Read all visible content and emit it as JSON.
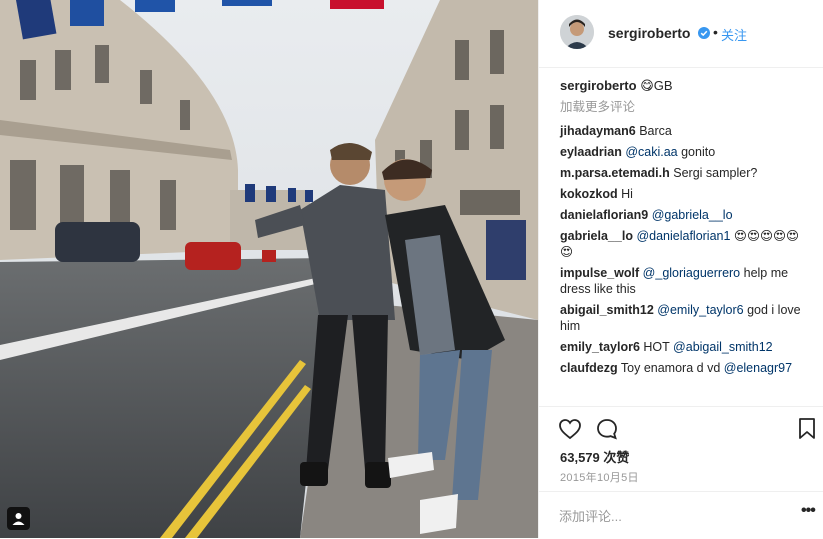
{
  "post": {
    "username": "sergiroberto",
    "separator": "•",
    "follow_label": "关注",
    "caption_user": "sergiroberto",
    "caption_text": "😋GB",
    "load_more_label": "加载更多评论",
    "comments": [
      {
        "user": "jihadayman6",
        "parts": [
          {
            "t": "Barca"
          }
        ]
      },
      {
        "user": "eylaadrian",
        "parts": [
          {
            "m": "@caki.aa"
          },
          {
            "t": " gonito"
          }
        ]
      },
      {
        "user": "m.parsa.etemadi.h",
        "parts": [
          {
            "t": "Sergi sampler?"
          }
        ]
      },
      {
        "user": "kokozkod",
        "parts": [
          {
            "t": "Hi"
          }
        ]
      },
      {
        "user": "danielaflorian9",
        "parts": [
          {
            "m": "@gabriela__lo"
          }
        ]
      },
      {
        "user": "gabriela__lo",
        "parts": [
          {
            "m": "@danielaflorian1"
          },
          {
            "t": " 😍😍😍😍😍😍"
          }
        ]
      },
      {
        "user": "impulse_wolf",
        "parts": [
          {
            "m": "@_gloriaguerrero"
          },
          {
            "t": " help me dress like this"
          }
        ]
      },
      {
        "user": "abigail_smith12",
        "parts": [
          {
            "m": "@emily_taylor6"
          },
          {
            "t": " god i love him"
          }
        ]
      },
      {
        "user": "emily_taylor6",
        "parts": [
          {
            "t": "HOT "
          },
          {
            "m": "@abigail_smith12"
          }
        ]
      },
      {
        "user": "claufdezg",
        "parts": [
          {
            "t": "Toy enamora d vd "
          },
          {
            "m": "@elenagr97"
          }
        ]
      }
    ],
    "likes": "63,579 次赞",
    "date": "2015年10月5日",
    "add_comment_placeholder": "添加评论...",
    "more_options": "•••"
  },
  "colors": {
    "link": "#3897f0",
    "mention": "#003569",
    "muted": "#999999",
    "verified": "#3897f0"
  },
  "icons": [
    "verified-icon",
    "heart-icon",
    "comment-bubble-icon",
    "bookmark-icon",
    "multiple-photos-icon"
  ]
}
